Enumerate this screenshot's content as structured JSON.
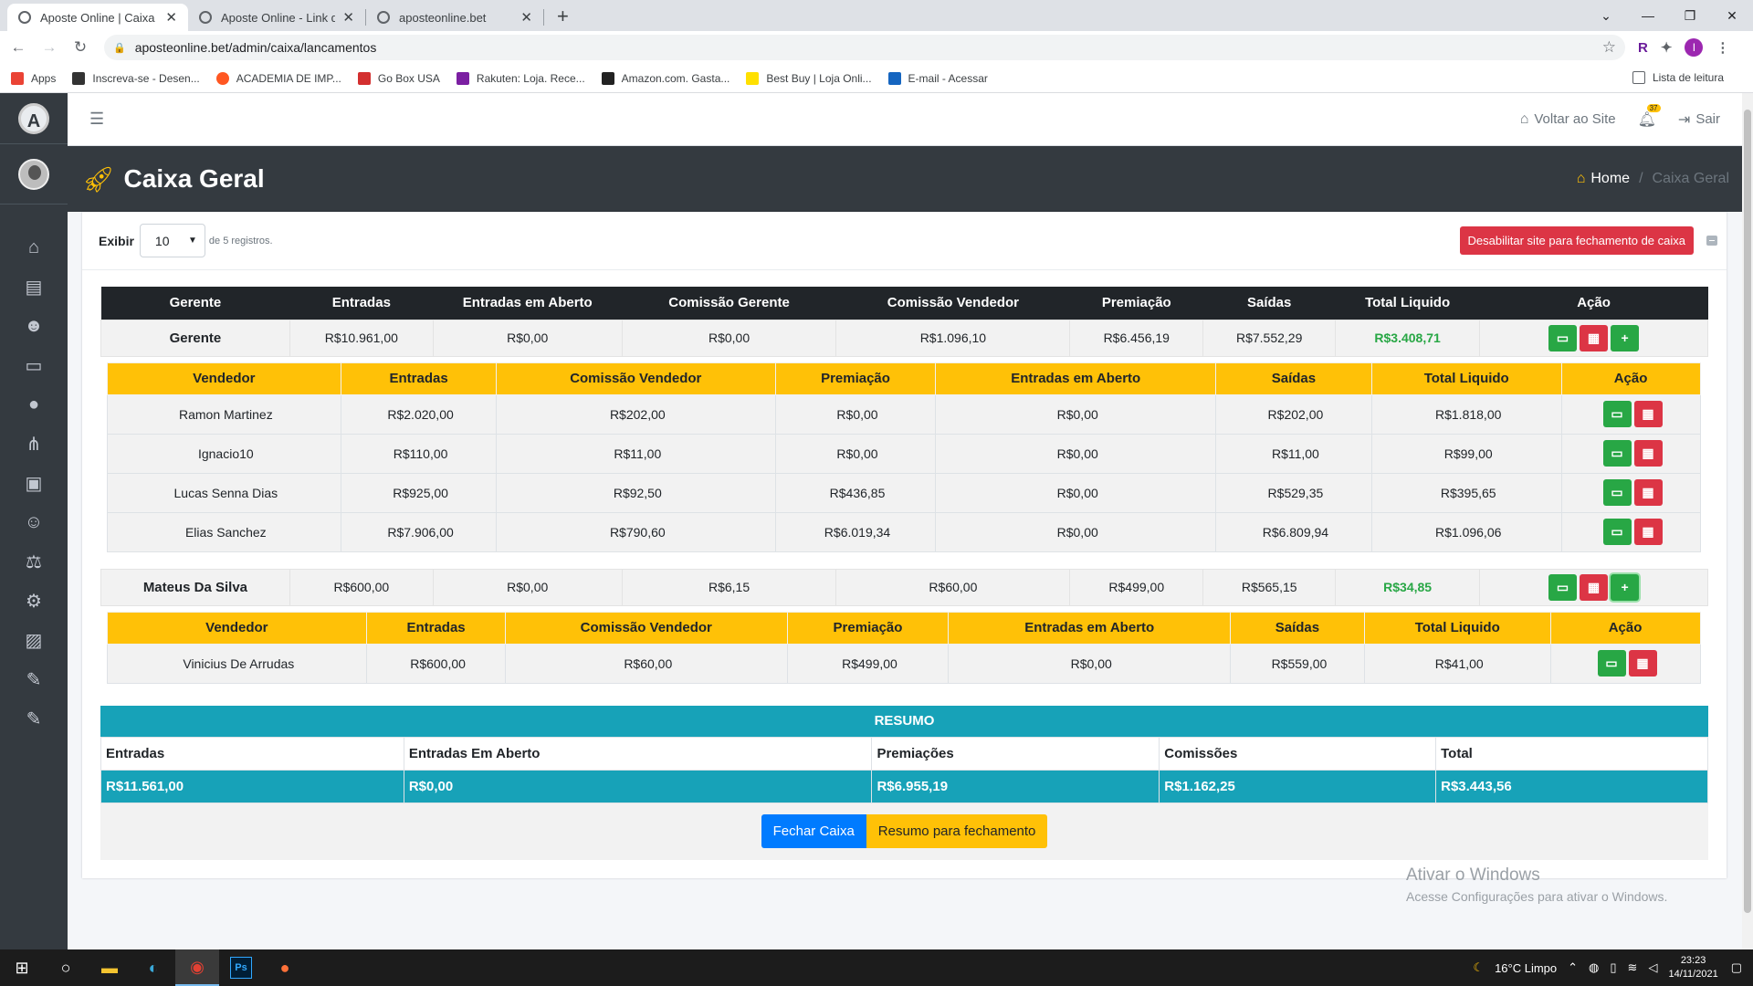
{
  "browser": {
    "tabs": [
      {
        "title": "Aposte Online | Caixa Geral",
        "active": true
      },
      {
        "title": "Aposte Online - Link do Bilhete",
        "active": false
      },
      {
        "title": "aposteonline.bet",
        "active": false
      }
    ],
    "url": "aposteonline.bet/admin/caixa/lancamentos",
    "profile_initial": "I",
    "extension_r": "R",
    "bookmarks": [
      "Apps",
      "Inscreva-se - Desen...",
      "ACADEMIA DE IMP...",
      "Go Box USA",
      "Rakuten: Loja. Rece...",
      "Amazon.com. Gasta...",
      "Best Buy | Loja Onli...",
      "E-mail - Acessar"
    ],
    "reading_list": "Lista de leitura"
  },
  "header": {
    "voltar": "Voltar ao Site",
    "notif_count": "37",
    "sair": "Sair"
  },
  "page": {
    "title": "Caixa Geral",
    "breadcrumb_home": "Home",
    "breadcrumb_current": "Caixa Geral"
  },
  "controls": {
    "exibir_label": "Exibir",
    "per_page": "10",
    "records_text": "de 5 registros.",
    "disable_button": "Desabilitar site para fechamento de caixa"
  },
  "gerente_table": {
    "headers": [
      "Gerente",
      "Entradas",
      "Entradas em Aberto",
      "Comissão Gerente",
      "Comissão Vendedor",
      "Premiação",
      "Saídas",
      "Total Liquido",
      "Ação"
    ],
    "groups": [
      {
        "row": [
          "Gerente",
          "R$10.961,00",
          "R$0,00",
          "R$0,00",
          "R$1.096,10",
          "R$6.456,19",
          "R$7.552,29",
          "R$3.408,71"
        ],
        "vend_headers": [
          "Vendedor",
          "Entradas",
          "Comissão Vendedor",
          "Premiação",
          "Entradas em Aberto",
          "Saídas",
          "Total Liquido",
          "Ação"
        ],
        "vendedores": [
          [
            "Ramon Martinez",
            "R$2.020,00",
            "R$202,00",
            "R$0,00",
            "R$0,00",
            "R$202,00",
            "R$1.818,00"
          ],
          [
            "Ignacio10",
            "R$110,00",
            "R$11,00",
            "R$0,00",
            "R$0,00",
            "R$11,00",
            "R$99,00"
          ],
          [
            "Lucas Senna Dias",
            "R$925,00",
            "R$92,50",
            "R$436,85",
            "R$0,00",
            "R$529,35",
            "R$395,65"
          ],
          [
            "Elias Sanchez",
            "R$7.906,00",
            "R$790,60",
            "R$6.019,34",
            "R$0,00",
            "R$6.809,94",
            "R$1.096,06"
          ]
        ]
      },
      {
        "row": [
          "Mateus Da Silva",
          "R$600,00",
          "R$0,00",
          "R$6,15",
          "R$60,00",
          "R$499,00",
          "R$565,15",
          "R$34,85"
        ],
        "vend_headers": [
          "Vendedor",
          "Entradas",
          "Comissão Vendedor",
          "Premiação",
          "Entradas em Aberto",
          "Saídas",
          "Total Liquido",
          "Ação"
        ],
        "vendedores": [
          [
            "Vinicius De Arrudas",
            "R$600,00",
            "R$60,00",
            "R$499,00",
            "R$0,00",
            "R$559,00",
            "R$41,00"
          ]
        ]
      }
    ]
  },
  "resumo": {
    "title": "RESUMO",
    "labels": [
      "Entradas",
      "Entradas Em Aberto",
      "Premiações",
      "Comissões",
      "Total"
    ],
    "values": [
      "R$11.561,00",
      "R$0,00",
      "R$6.955,19",
      "R$1.162,25",
      "R$3.443,56"
    ]
  },
  "buttons": {
    "fechar": "Fechar Caixa",
    "resumo": "Resumo para fechamento"
  },
  "watermark": {
    "line1": "Ativar o Windows",
    "line2": "Acesse Configurações para ativar o Windows."
  },
  "taskbar": {
    "weather": "16°C  Limpo",
    "time": "23:23",
    "date": "14/11/2021",
    "ps_label": "Ps"
  },
  "colors": {
    "sidebar": "#343a40",
    "accent_yellow": "#ffc107",
    "success": "#28a745",
    "danger": "#dc3545",
    "info": "#17a2b8",
    "primary": "#007bff"
  }
}
